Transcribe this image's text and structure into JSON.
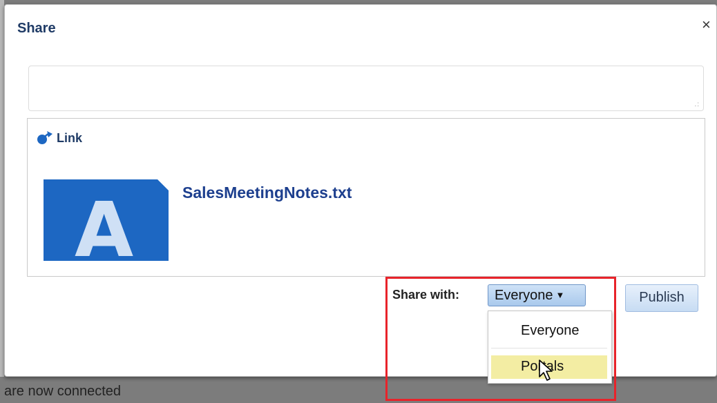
{
  "dialog": {
    "title": "Share",
    "close_glyph": "×",
    "comment": {
      "value": "",
      "placeholder": ""
    }
  },
  "link_card": {
    "label": "Link",
    "icon": "share-arrow-icon",
    "thumbnail_letter": "A",
    "file_name": "SalesMeetingNotes.txt"
  },
  "share_with": {
    "label": "Share with:",
    "selected": "Everyone",
    "options": [
      {
        "label": "Everyone",
        "highlighted": false
      },
      {
        "label": "Portals",
        "highlighted": true
      }
    ]
  },
  "publish_label": "Publish",
  "background_text": "are now connected",
  "colors": {
    "accent": "#1d67c2",
    "highlight_frame": "#e8232a",
    "option_hover": "#f3eda3"
  }
}
